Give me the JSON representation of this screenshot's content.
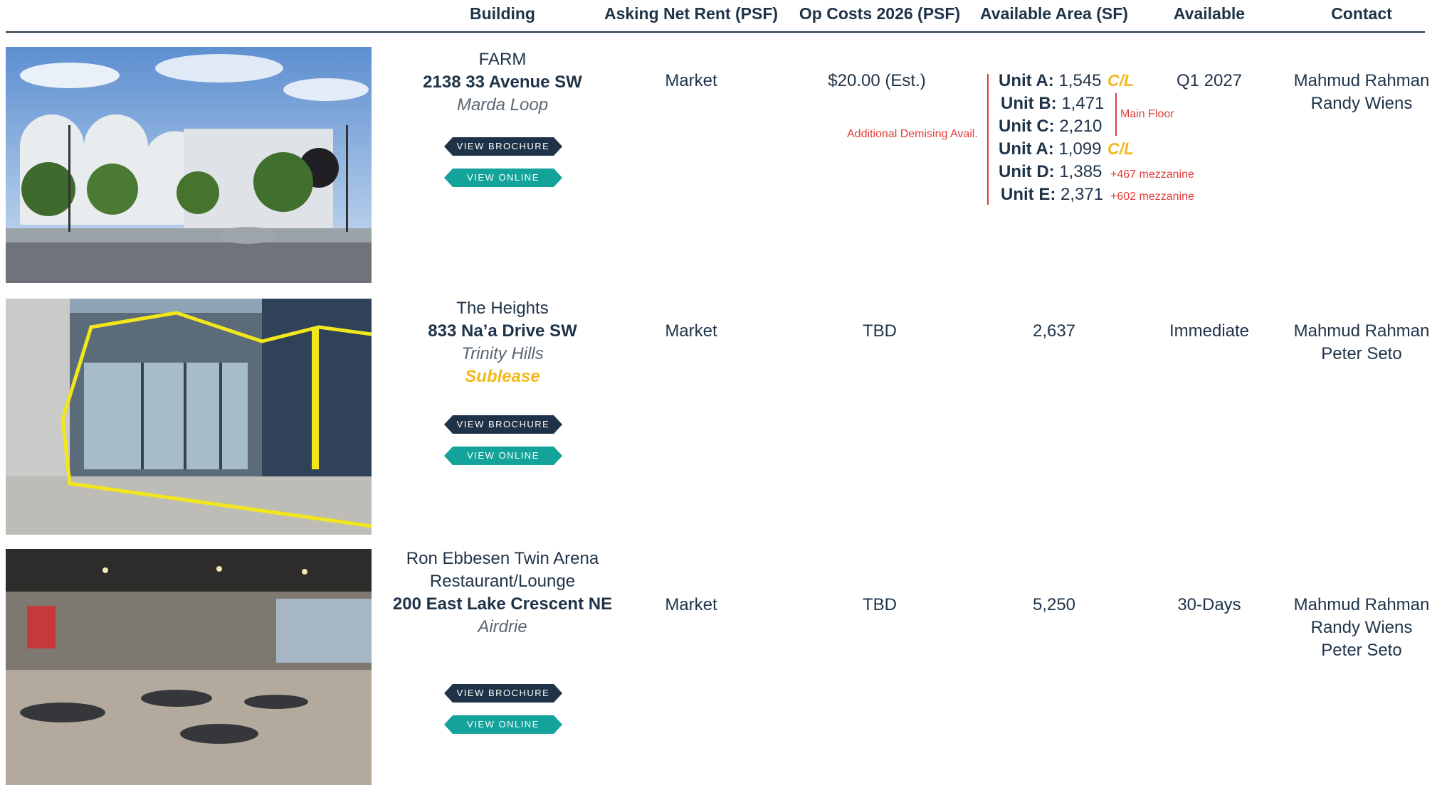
{
  "columns": [
    "Building",
    "Asking Net Rent (PSF)",
    "Op Costs 2026 (PSF)",
    "Available Area (SF)",
    "Available",
    "Contact"
  ],
  "buttons": {
    "brochure": "VIEW BROCHURE",
    "online": "VIEW ONLINE"
  },
  "colors": {
    "navy": "#1f3348",
    "teal": "#13a39a",
    "yellow": "#f3b81c",
    "red": "#e23b3b"
  },
  "listings": [
    {
      "name": "FARM",
      "address": "2138 33 Avenue SW",
      "area": "Marda Loop",
      "rent": "Market",
      "op_costs": "$20.00 (Est.)",
      "demising_note": "Additional Demising Avail.",
      "units": [
        {
          "label": "Unit A:",
          "value": "1,545",
          "tag": "C/L"
        },
        {
          "label": "Unit B:",
          "value": "1,471",
          "tag": ""
        },
        {
          "label": "Unit C:",
          "value": "2,210",
          "tag": ""
        },
        {
          "label": "Unit A:",
          "value": "1,099",
          "tag": "C/L"
        },
        {
          "label": "Unit D:",
          "value": "1,385",
          "tag": "",
          "note": "+467 mezzanine"
        },
        {
          "label": "Unit E:",
          "value": "2,371",
          "tag": "",
          "note": "+602 mezzanine"
        }
      ],
      "main_floor_note": "Main Floor",
      "available": "Q1 2027",
      "contacts": [
        "Mahmud Rahman",
        "Randy Wiens"
      ]
    },
    {
      "name": "The Heights",
      "address": "833 Na’a Drive SW",
      "area": "Trinity Hills",
      "sublease": "Sublease",
      "rent": "Market",
      "op_costs": "TBD",
      "area_sf": "2,637",
      "available": "Immediate",
      "contacts": [
        "Mahmud Rahman",
        "Peter Seto"
      ]
    },
    {
      "name_line1": "Ron Ebbesen Twin Arena",
      "name_line2": "Restaurant/Lounge",
      "address": "200 East Lake Crescent NE",
      "area": "Airdrie",
      "rent": "Market",
      "op_costs": "TBD",
      "area_sf": "5,250",
      "available": "30-Days",
      "contacts": [
        "Mahmud Rahman",
        "Randy Wiens",
        "Peter Seto"
      ]
    }
  ]
}
